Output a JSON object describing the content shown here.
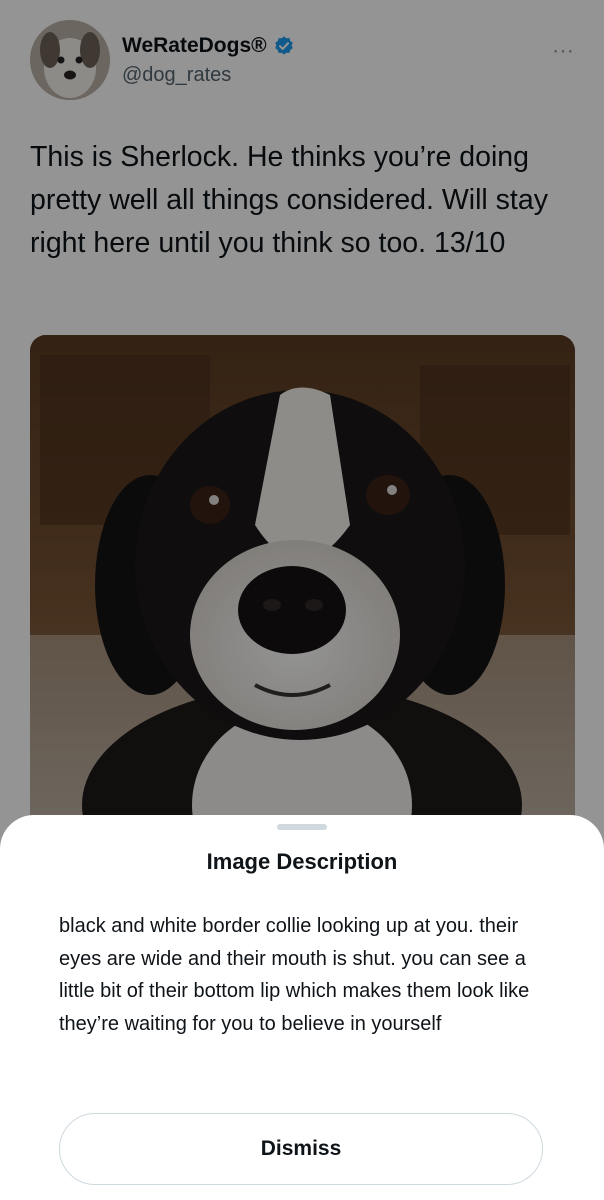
{
  "tweet": {
    "author_name": "WeRateDogs®",
    "author_handle": "@dog_rates",
    "verified": true,
    "more_icon": "⋯",
    "text": "This is Sherlock. He thinks you’re doing pretty well all things considered. Will stay right here until you think so too. 13/10"
  },
  "sheet": {
    "title": "Image Description",
    "description": "black and white border collie looking up at you. their eyes are wide and their mouth is shut. you can see a little bit of their bottom lip which makes them look like they’re waiting for you to believe in yourself",
    "dismiss_label": "Dismiss"
  },
  "colors": {
    "verified_blue": "#1d9bf0",
    "text": "#0f1419",
    "secondary_text": "#536471"
  }
}
